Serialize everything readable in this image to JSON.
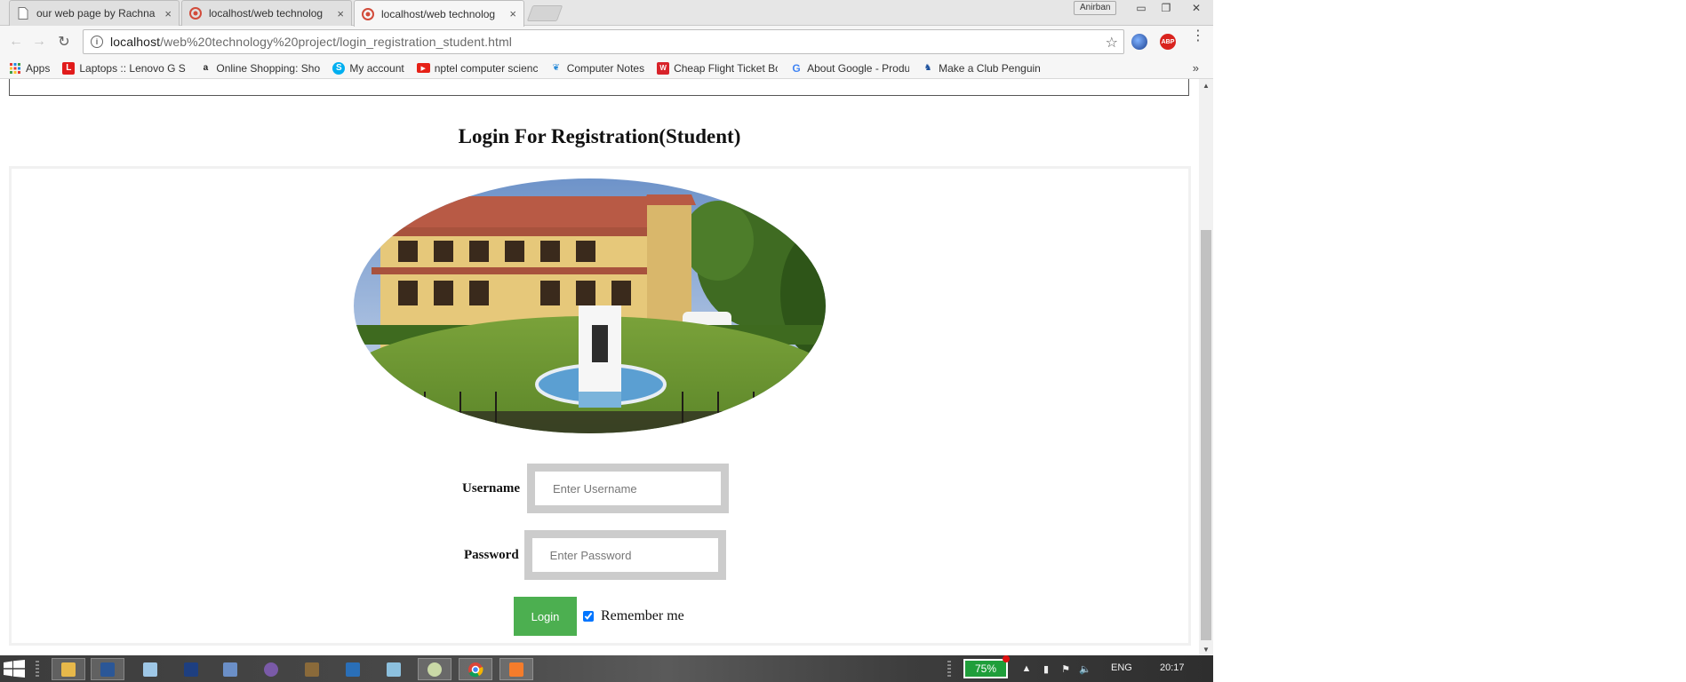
{
  "browser": {
    "tabs": [
      {
        "title": "our web page by Rachna",
        "close": "×",
        "active": false,
        "icon": "document-icon"
      },
      {
        "title": "localhost/web technolog",
        "close": "×",
        "active": false,
        "icon": "app-icon"
      },
      {
        "title": "localhost/web technolog",
        "close": "×",
        "active": true,
        "icon": "app-icon"
      }
    ],
    "profile_name": "Anirban",
    "window_controls": {
      "minimize": "▭",
      "restore": "❐",
      "close": "✕"
    },
    "nav": {
      "back": "←",
      "forward": "→",
      "reload": "↻"
    },
    "address_bar": {
      "host": "localhost",
      "path": "/web%20technology%20project/login_registration_student.html"
    },
    "bookmark_star": "☆",
    "extensions": {
      "abp_label": "ABP"
    },
    "menu": "⋮",
    "bookmarks": [
      {
        "label": "Apps",
        "icon": "apps-grid-icon",
        "color": "#e53935"
      },
      {
        "label": "Laptops :: Lenovo G S",
        "icon": "lenovo-icon",
        "color": "#e11b1b"
      },
      {
        "label": "Online Shopping: Sho",
        "icon": "amazon-icon",
        "color": "#222222"
      },
      {
        "label": "My account",
        "icon": "skype-icon",
        "color": "#00aff0"
      },
      {
        "label": "nptel computer scienc",
        "icon": "youtube-icon",
        "color": "#e62117"
      },
      {
        "label": "Computer Notes",
        "icon": "computer-notes-icon",
        "color": "#2a8bd8"
      },
      {
        "label": "Cheap Flight Ticket Bo",
        "icon": "flight-icon",
        "color": "#d8232a"
      },
      {
        "label": "About Google - Produ",
        "icon": "google-icon",
        "color": "#4285f4"
      },
      {
        "label": "Make a Club Penguin",
        "icon": "penguin-icon",
        "color": "#1b4f9c"
      }
    ],
    "bookmarks_overflow": "»"
  },
  "page": {
    "heading": "Login For Registration(Student)",
    "username_label": "Username",
    "username_placeholder": "Enter Username",
    "password_label": "Password",
    "password_placeholder": "Enter Password",
    "login_button": "Login",
    "remember_label": "Remember me",
    "remember_checked": true
  },
  "scrollbar": {
    "up": "▲",
    "down": "▼"
  },
  "taskbar": {
    "battery": "75%",
    "language": "ENG",
    "time": "20:17"
  },
  "colors": {
    "login_button": "#4caf50",
    "field_frame": "#cccccc",
    "battery": "#1f9e3a"
  }
}
